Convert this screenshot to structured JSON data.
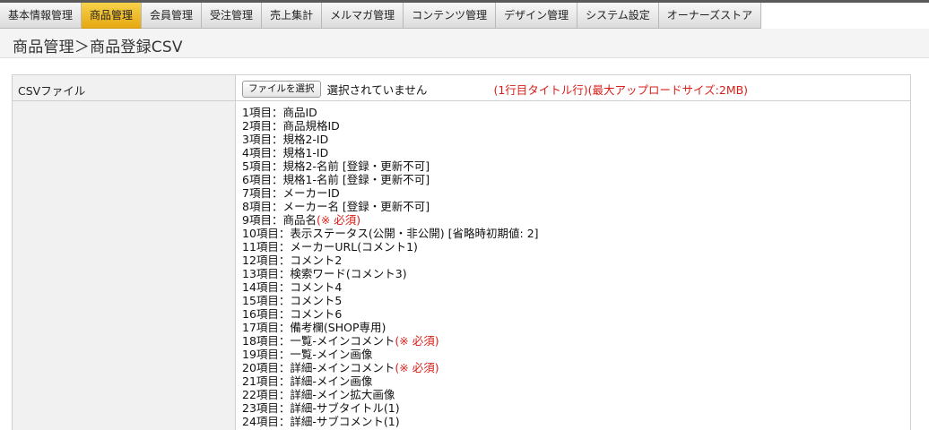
{
  "nav": [
    {
      "label": "基本情報管理",
      "active": false
    },
    {
      "label": "商品管理",
      "active": true
    },
    {
      "label": "会員管理",
      "active": false
    },
    {
      "label": "受注管理",
      "active": false
    },
    {
      "label": "売上集計",
      "active": false
    },
    {
      "label": "メルマガ管理",
      "active": false
    },
    {
      "label": "コンテンツ管理",
      "active": false
    },
    {
      "label": "デザイン管理",
      "active": false
    },
    {
      "label": "システム設定",
      "active": false
    },
    {
      "label": "オーナーズストア",
      "active": false
    }
  ],
  "page_title": "商品管理＞商品登録CSV",
  "form": {
    "csv_label": "CSVファイル",
    "file_button": "ファイルを選択",
    "file_status": "選択されていません",
    "file_note": "(1行目タイトル行)(最大アップロードサイズ:2MB)",
    "items": [
      {
        "text": "1項目：商品ID",
        "req": ""
      },
      {
        "text": "2項目：商品規格ID",
        "req": ""
      },
      {
        "text": "3項目：規格2-ID",
        "req": ""
      },
      {
        "text": "4項目：規格1-ID",
        "req": ""
      },
      {
        "text": "5項目：規格2-名前 [登録・更新不可]",
        "req": ""
      },
      {
        "text": "6項目：規格1-名前 [登録・更新不可]",
        "req": ""
      },
      {
        "text": "7項目：メーカーID",
        "req": ""
      },
      {
        "text": "8項目：メーカー名 [登録・更新不可]",
        "req": ""
      },
      {
        "text": "9項目：商品名",
        "req": "(※ 必須)"
      },
      {
        "text": "10項目：表示ステータス(公開・非公開) [省略時初期値: 2]",
        "req": ""
      },
      {
        "text": "11項目：メーカーURL(コメント1)",
        "req": ""
      },
      {
        "text": "12項目：コメント2",
        "req": ""
      },
      {
        "text": "13項目：検索ワード(コメント3)",
        "req": ""
      },
      {
        "text": "14項目：コメント4",
        "req": ""
      },
      {
        "text": "15項目：コメント5",
        "req": ""
      },
      {
        "text": "16項目：コメント6",
        "req": ""
      },
      {
        "text": "17項目：備考欄(SHOP専用)",
        "req": ""
      },
      {
        "text": "18項目：一覧-メインコメント",
        "req": "(※ 必須)"
      },
      {
        "text": "19項目：一覧-メイン画像",
        "req": ""
      },
      {
        "text": "20項目：詳細-メインコメント",
        "req": "(※ 必須)"
      },
      {
        "text": "21項目：詳細-メイン画像",
        "req": ""
      },
      {
        "text": "22項目：詳細-メイン拡大画像",
        "req": ""
      },
      {
        "text": "23項目：詳細-サブタイトル(1)",
        "req": ""
      },
      {
        "text": "24項目：詳細-サブコメント(1)",
        "req": ""
      }
    ]
  },
  "colors": {
    "active_tab": "#f0bf2c",
    "required_text": "#d91e18",
    "label_bg": "#f1f1f1"
  }
}
